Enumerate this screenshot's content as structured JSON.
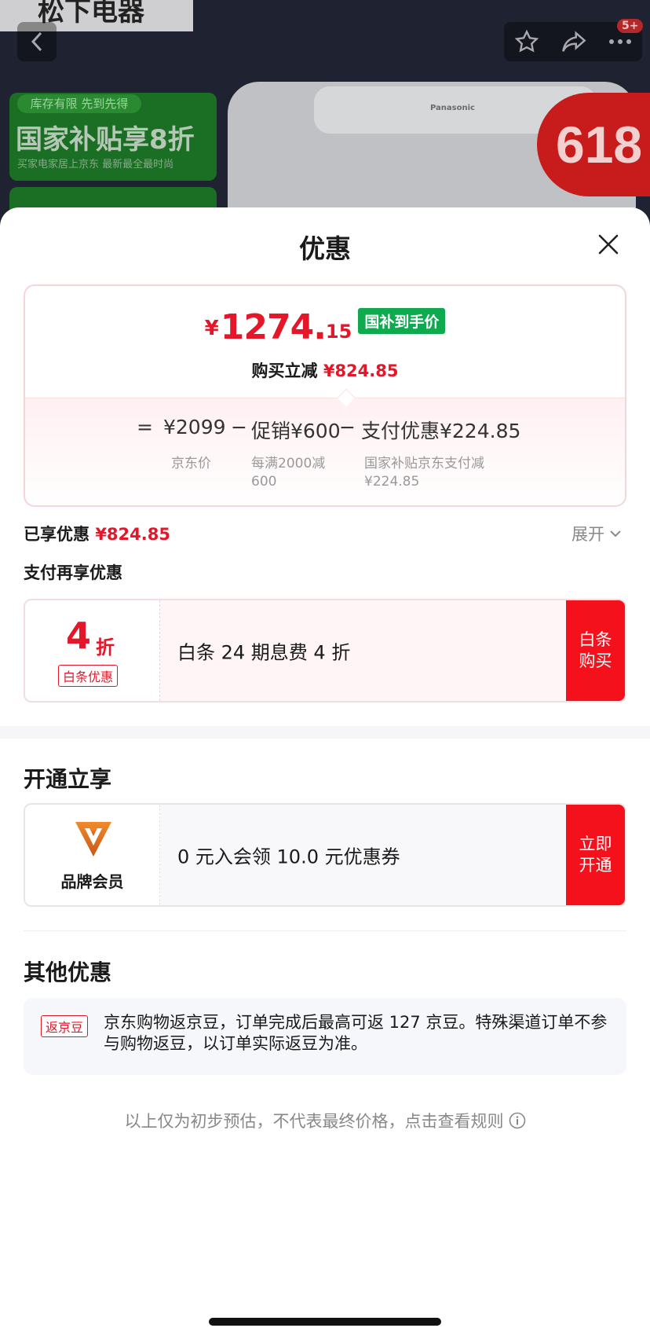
{
  "background": {
    "top_text": "松下电器",
    "brand": "Panasonic",
    "promo_tag": "库存有限 先到先得",
    "promo_main": "国家补贴享8折",
    "promo_sub": "买家电家居上京东 最新最全最时尚",
    "badge_618": "618",
    "cart_badge": "5+"
  },
  "sheet": {
    "title": "优惠"
  },
  "price_card": {
    "currency": "¥",
    "price_int": "1274.",
    "price_dec": "15",
    "price_tag": "国补到手价",
    "saved_label": "购买立减",
    "saved_value": "¥824.85",
    "formula": {
      "eq": "=",
      "base": "¥2099",
      "minus1": "−",
      "promo": "促销¥600",
      "minus2": "−",
      "pay": "支付优惠¥224.85"
    },
    "notes": {
      "base": "京东价",
      "promo": "每满2000减600",
      "pay": "国家补贴京东支付减¥224.85"
    }
  },
  "enjoyed": {
    "label": "已享优惠",
    "value": "¥824.85",
    "expand": "展开"
  },
  "pay_more_title": "支付再享优惠",
  "baitiao": {
    "discount_num": "4",
    "discount_unit": "折",
    "label": "白条优惠",
    "text": "白条 24 期息费 4 折",
    "button": "白条购买"
  },
  "membership": {
    "section_title": "开通立享",
    "label": "品牌会员",
    "text": "0 元入会领 10.0 元优惠券",
    "button": "立即开通",
    "accent": "#e8781f"
  },
  "other": {
    "section_title": "其他优惠",
    "tag": "返京豆",
    "text": "京东购物返京豆，订单完成后最高可返 127 京豆。特殊渠道订单不参与购物返豆，以订单实际返豆为准。"
  },
  "footer_note": "以上仅为初步预估，不代表最终价格，点击查看规则",
  "colors": {
    "red": "#e4172a",
    "button_red": "#f5111c",
    "green_tag": "#0faa4f"
  }
}
